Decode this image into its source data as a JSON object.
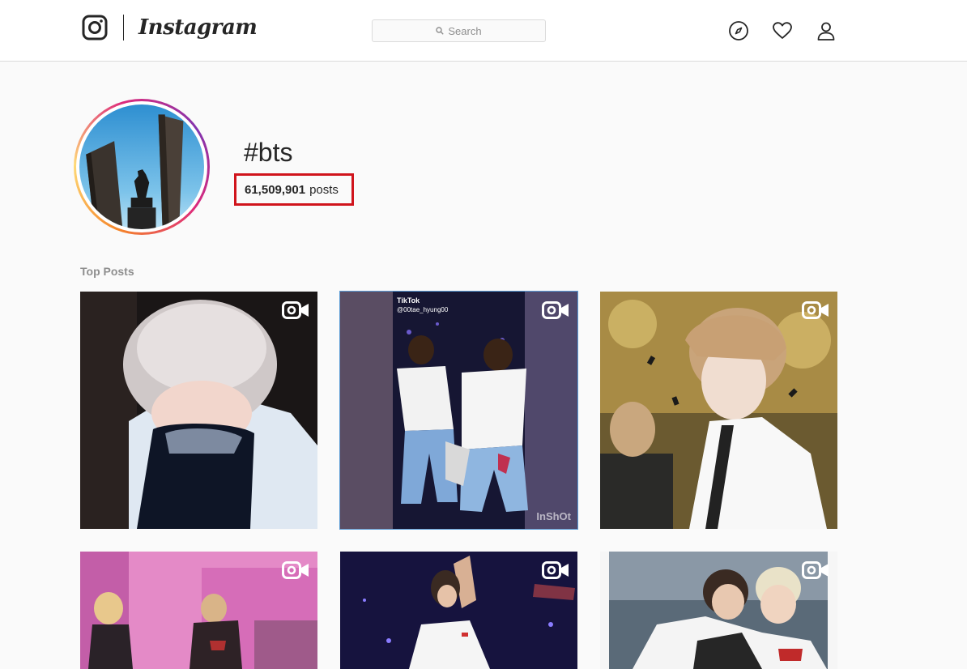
{
  "nav": {
    "wordmark": "Instagram",
    "search_placeholder": "Search",
    "icons": [
      "instagram-logo-icon",
      "explore-compass-icon",
      "heart-icon",
      "profile-icon"
    ]
  },
  "header": {
    "hashtag": "#bts",
    "post_count": "61,509,901",
    "post_count_suffix": "posts",
    "highlight_color": "#d0141c"
  },
  "section": {
    "label": "Top Posts"
  },
  "posts": [
    {
      "type": "video",
      "icon": "video-camera-icon"
    },
    {
      "type": "video",
      "icon": "video-camera-icon",
      "watermark_top": "TikTok",
      "watermark_user": "@00tae_hyung00",
      "watermark_bottom": "InShOt"
    },
    {
      "type": "video",
      "icon": "video-camera-icon"
    },
    {
      "type": "video",
      "icon": "video-camera-icon"
    },
    {
      "type": "video",
      "icon": "video-camera-icon"
    },
    {
      "type": "video",
      "icon": "video-camera-icon"
    }
  ]
}
